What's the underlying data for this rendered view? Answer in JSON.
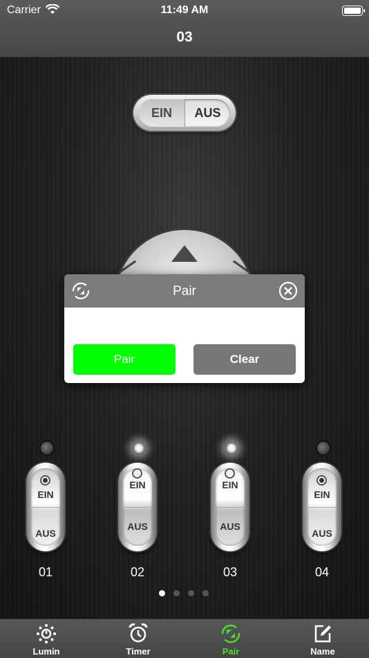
{
  "status_bar": {
    "carrier": "Carrier",
    "time": "11:49 AM"
  },
  "nav": {
    "title": "03"
  },
  "master_switch": {
    "on_label": "EIN",
    "off_label": "AUS"
  },
  "modal": {
    "title": "Pair",
    "pair_label": "Pair",
    "clear_label": "Clear",
    "colors": {
      "pair": "#00ff00",
      "clear": "#777777",
      "header": "#7b7b7b"
    }
  },
  "channels": [
    {
      "label": "01",
      "on_label": "EIN",
      "off_label": "AUS",
      "led_on": false,
      "state": "down"
    },
    {
      "label": "02",
      "on_label": "EIN",
      "off_label": "AUS",
      "led_on": true,
      "state": "up"
    },
    {
      "label": "03",
      "on_label": "EIN",
      "off_label": "AUS",
      "led_on": true,
      "state": "up"
    },
    {
      "label": "04",
      "on_label": "EIN",
      "off_label": "AUS",
      "led_on": false,
      "state": "down"
    }
  ],
  "pager": {
    "count": 4,
    "active_index": 0
  },
  "tabbar": {
    "active_color": "#4cdd2a",
    "tabs": [
      {
        "label": "Lumin",
        "icon": "sun-icon"
      },
      {
        "label": "Timer",
        "icon": "alarm-clock-icon"
      },
      {
        "label": "Pair",
        "icon": "sync-icon",
        "active": true
      },
      {
        "label": "Name",
        "icon": "edit-icon"
      }
    ]
  }
}
